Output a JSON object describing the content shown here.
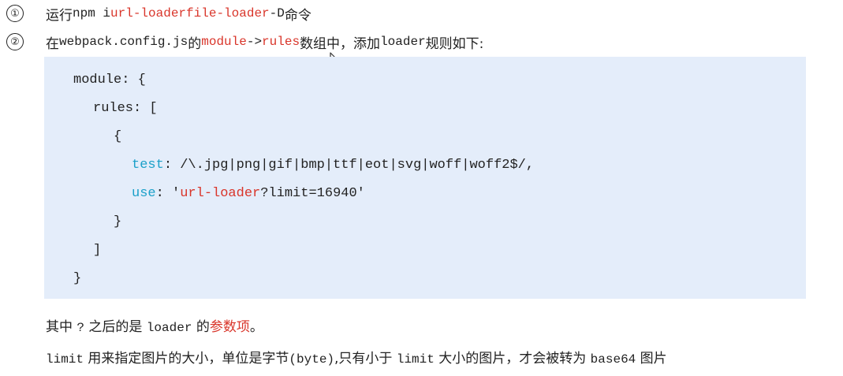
{
  "steps": [
    {
      "number": "①",
      "p1": "运行 ",
      "cmd": "npm i ",
      "pkg1": "url-loader",
      "space": " ",
      "pkg2": "file-loader",
      "flag": " -D ",
      "p2": "命令"
    },
    {
      "number": "②",
      "p1": "在 ",
      "file": "webpack.config.js",
      "p2": " 的 ",
      "kw1": "module",
      "arrow": " -> ",
      "kw2": "rules",
      "p3": " 数组中，添加 ",
      "loader": "loader",
      "p4": " 规则如下:"
    }
  ],
  "code": {
    "line1": "module: {",
    "line2": "rules: [",
    "line3": "{",
    "test_key": "test",
    "test_value": ": /\\.jpg|png|gif|bmp|ttf|eot|svg|woff|woff2$/,",
    "use_key": "use",
    "use_colon": ": '",
    "use_loader": "url-loader",
    "use_rest": "?limit=16940'",
    "line6": "}",
    "line7": "]",
    "line8": "}"
  },
  "notes": {
    "line1": {
      "p1": "其中 ",
      "q": "?",
      "p2": " 之后的是 ",
      "loader": "loader",
      "p3": " 的",
      "highlight": "参数项",
      "end": "。"
    },
    "line2": {
      "limit1": "limit",
      "p1": " 用来指定图片的大小，单位是字节",
      "byte": "(byte)",
      "p2": ",只有小于 ",
      "limit2": "limit",
      "p3": " 大小的图片，才会被转为 ",
      "base64": "base64",
      "p4": " 图片"
    }
  }
}
